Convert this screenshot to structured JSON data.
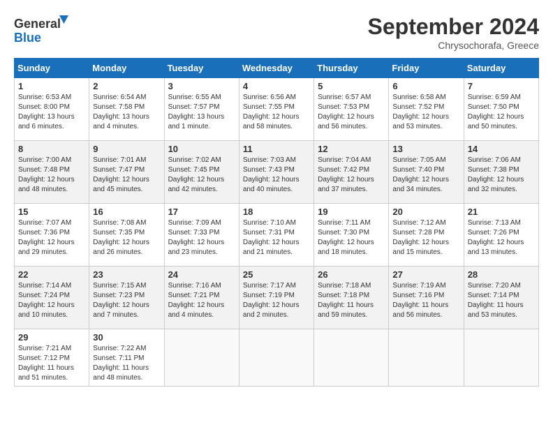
{
  "logo": {
    "line1": "General",
    "line2": "Blue"
  },
  "title": "September 2024",
  "location": "Chrysochorafa, Greece",
  "days_of_week": [
    "Sunday",
    "Monday",
    "Tuesday",
    "Wednesday",
    "Thursday",
    "Friday",
    "Saturday"
  ],
  "weeks": [
    [
      {
        "day": "1",
        "info": "Sunrise: 6:53 AM\nSunset: 8:00 PM\nDaylight: 13 hours\nand 6 minutes."
      },
      {
        "day": "2",
        "info": "Sunrise: 6:54 AM\nSunset: 7:58 PM\nDaylight: 13 hours\nand 4 minutes."
      },
      {
        "day": "3",
        "info": "Sunrise: 6:55 AM\nSunset: 7:57 PM\nDaylight: 13 hours\nand 1 minute."
      },
      {
        "day": "4",
        "info": "Sunrise: 6:56 AM\nSunset: 7:55 PM\nDaylight: 12 hours\nand 58 minutes."
      },
      {
        "day": "5",
        "info": "Sunrise: 6:57 AM\nSunset: 7:53 PM\nDaylight: 12 hours\nand 56 minutes."
      },
      {
        "day": "6",
        "info": "Sunrise: 6:58 AM\nSunset: 7:52 PM\nDaylight: 12 hours\nand 53 minutes."
      },
      {
        "day": "7",
        "info": "Sunrise: 6:59 AM\nSunset: 7:50 PM\nDaylight: 12 hours\nand 50 minutes."
      }
    ],
    [
      {
        "day": "8",
        "info": "Sunrise: 7:00 AM\nSunset: 7:48 PM\nDaylight: 12 hours\nand 48 minutes."
      },
      {
        "day": "9",
        "info": "Sunrise: 7:01 AM\nSunset: 7:47 PM\nDaylight: 12 hours\nand 45 minutes."
      },
      {
        "day": "10",
        "info": "Sunrise: 7:02 AM\nSunset: 7:45 PM\nDaylight: 12 hours\nand 42 minutes."
      },
      {
        "day": "11",
        "info": "Sunrise: 7:03 AM\nSunset: 7:43 PM\nDaylight: 12 hours\nand 40 minutes."
      },
      {
        "day": "12",
        "info": "Sunrise: 7:04 AM\nSunset: 7:42 PM\nDaylight: 12 hours\nand 37 minutes."
      },
      {
        "day": "13",
        "info": "Sunrise: 7:05 AM\nSunset: 7:40 PM\nDaylight: 12 hours\nand 34 minutes."
      },
      {
        "day": "14",
        "info": "Sunrise: 7:06 AM\nSunset: 7:38 PM\nDaylight: 12 hours\nand 32 minutes."
      }
    ],
    [
      {
        "day": "15",
        "info": "Sunrise: 7:07 AM\nSunset: 7:36 PM\nDaylight: 12 hours\nand 29 minutes."
      },
      {
        "day": "16",
        "info": "Sunrise: 7:08 AM\nSunset: 7:35 PM\nDaylight: 12 hours\nand 26 minutes."
      },
      {
        "day": "17",
        "info": "Sunrise: 7:09 AM\nSunset: 7:33 PM\nDaylight: 12 hours\nand 23 minutes."
      },
      {
        "day": "18",
        "info": "Sunrise: 7:10 AM\nSunset: 7:31 PM\nDaylight: 12 hours\nand 21 minutes."
      },
      {
        "day": "19",
        "info": "Sunrise: 7:11 AM\nSunset: 7:30 PM\nDaylight: 12 hours\nand 18 minutes."
      },
      {
        "day": "20",
        "info": "Sunrise: 7:12 AM\nSunset: 7:28 PM\nDaylight: 12 hours\nand 15 minutes."
      },
      {
        "day": "21",
        "info": "Sunrise: 7:13 AM\nSunset: 7:26 PM\nDaylight: 12 hours\nand 13 minutes."
      }
    ],
    [
      {
        "day": "22",
        "info": "Sunrise: 7:14 AM\nSunset: 7:24 PM\nDaylight: 12 hours\nand 10 minutes."
      },
      {
        "day": "23",
        "info": "Sunrise: 7:15 AM\nSunset: 7:23 PM\nDaylight: 12 hours\nand 7 minutes."
      },
      {
        "day": "24",
        "info": "Sunrise: 7:16 AM\nSunset: 7:21 PM\nDaylight: 12 hours\nand 4 minutes."
      },
      {
        "day": "25",
        "info": "Sunrise: 7:17 AM\nSunset: 7:19 PM\nDaylight: 12 hours\nand 2 minutes."
      },
      {
        "day": "26",
        "info": "Sunrise: 7:18 AM\nSunset: 7:18 PM\nDaylight: 11 hours\nand 59 minutes."
      },
      {
        "day": "27",
        "info": "Sunrise: 7:19 AM\nSunset: 7:16 PM\nDaylight: 11 hours\nand 56 minutes."
      },
      {
        "day": "28",
        "info": "Sunrise: 7:20 AM\nSunset: 7:14 PM\nDaylight: 11 hours\nand 53 minutes."
      }
    ],
    [
      {
        "day": "29",
        "info": "Sunrise: 7:21 AM\nSunset: 7:12 PM\nDaylight: 11 hours\nand 51 minutes."
      },
      {
        "day": "30",
        "info": "Sunrise: 7:22 AM\nSunset: 7:11 PM\nDaylight: 11 hours\nand 48 minutes."
      },
      {
        "day": "",
        "info": ""
      },
      {
        "day": "",
        "info": ""
      },
      {
        "day": "",
        "info": ""
      },
      {
        "day": "",
        "info": ""
      },
      {
        "day": "",
        "info": ""
      }
    ]
  ]
}
